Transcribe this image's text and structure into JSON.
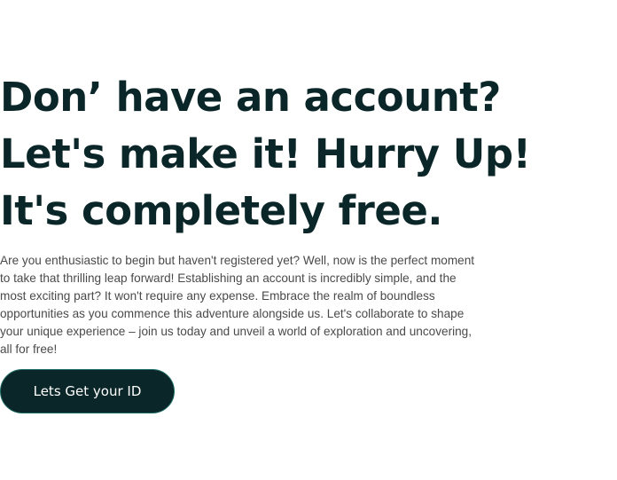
{
  "hero": {
    "headline_lines": [
      "Don’ have an account?",
      "Let's make it! Hurry Up!",
      "It's completely free."
    ],
    "description": "Are you enthusiastic to begin but haven't registered yet? Well, now is the perfect moment to take that thrilling leap forward! Establishing an account is incredibly simple, and the most exciting part? It won't require any expense. Embrace the realm of boundless opportunities as you commence this adventure alongside us. Let's collaborate to shape your unique experience – join us today and unveil a world of exploration and uncovering, all for free!",
    "cta_label": "Lets Get your ID"
  },
  "colors": {
    "headline": "#0b2628",
    "button_bg": "#0b2628",
    "button_border": "#1f6d66",
    "body_text": "#4a4a4a"
  }
}
